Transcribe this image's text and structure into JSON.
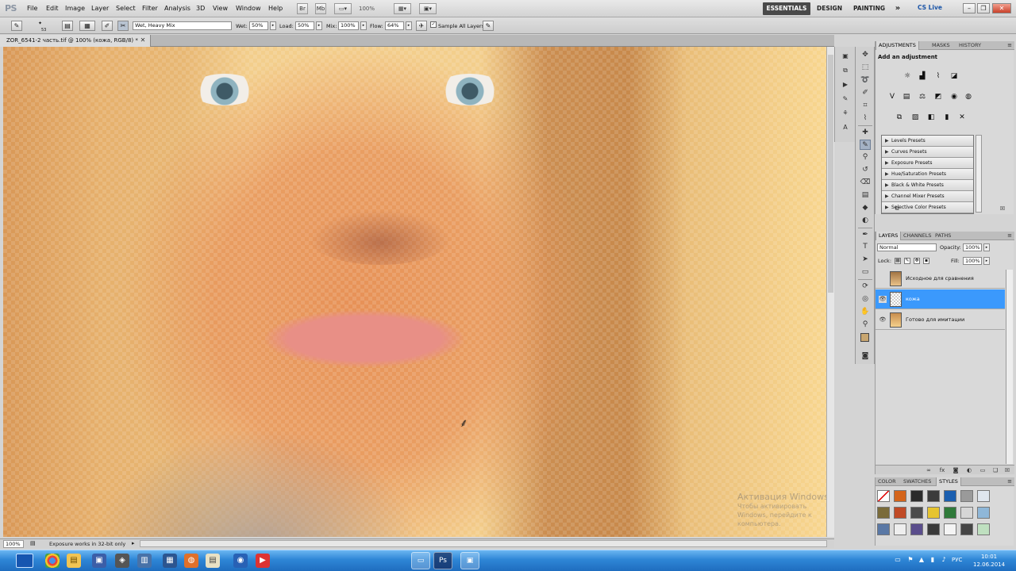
{
  "app": {
    "logo": "PS"
  },
  "menu": [
    "File",
    "Edit",
    "Image",
    "Layer",
    "Select",
    "Filter",
    "Analysis",
    "3D",
    "View",
    "Window",
    "Help"
  ],
  "menubar": {
    "zoom": "100%",
    "workspaces": [
      "ESSENTIALS",
      "DESIGN",
      "PAINTING"
    ],
    "more": "»",
    "cs_live": "CS Live"
  },
  "options": {
    "brush_size": "53",
    "mix_mode": "Wet, Heavy Mix",
    "wet_label": "Wet:",
    "wet_value": "50%",
    "load_label": "Load:",
    "load_value": "50%",
    "mix_label": "Mix:",
    "mix_value": "100%",
    "flow_label": "Flow:",
    "flow_value": "64%",
    "sample_label": "Sample All Layers"
  },
  "document": {
    "tab_title": "ZOR_6541-2 часть.tif @ 100% (кожа, RGB/8) *"
  },
  "watermark": {
    "title": "Активация Windows",
    "subtitle": "Чтобы активировать Windows, перейдите к компьютера."
  },
  "status": {
    "zoom": "100%",
    "message": "Exposure works in 32-bit only"
  },
  "adjustments": {
    "tabs": [
      "ADJUSTMENTS",
      "MASKS",
      "HISTORY"
    ],
    "title": "Add an adjustment",
    "presets": [
      "Levels Presets",
      "Curves Presets",
      "Exposure Presets",
      "Hue/Saturation Presets",
      "Black & White Presets",
      "Channel Mixer Presets",
      "Selective Color Presets"
    ]
  },
  "layers_panel": {
    "tabs": [
      "LAYERS",
      "CHANNELS",
      "PATHS"
    ],
    "blend_mode": "Normal",
    "opacity_label": "Opacity:",
    "opacity_value": "100%",
    "lock_label": "Lock:",
    "fill_label": "Fill:",
    "fill_value": "100%",
    "layers": [
      {
        "name": "Исходное для сравнения",
        "visible": false,
        "selected": false
      },
      {
        "name": "кожа",
        "visible": true,
        "selected": true
      },
      {
        "name": "Готово для имитации",
        "visible": true,
        "selected": false
      }
    ]
  },
  "styles_panel": {
    "tabs": [
      "COLOR",
      "SWATCHES",
      "STYLES"
    ]
  },
  "taskbar": {
    "language": "РУС",
    "time": "10:01",
    "date": "12.06.2014"
  },
  "colors": {
    "selection": "#3b99fc",
    "foreground": "#c8a670",
    "background": "#ffffff"
  }
}
